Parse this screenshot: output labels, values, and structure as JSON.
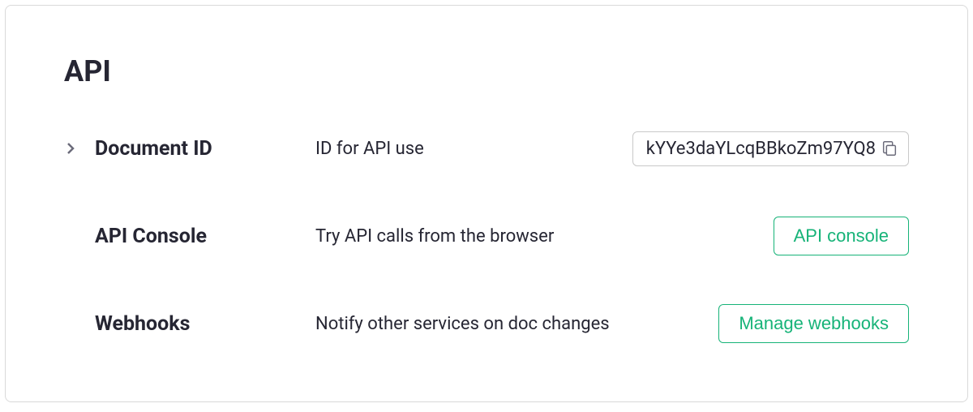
{
  "section": {
    "title": "API"
  },
  "rows": {
    "documentId": {
      "label": "Document ID",
      "description": "ID for API use",
      "value": "kYYe3daYLcqBBkoZm97YQ8"
    },
    "apiConsole": {
      "label": "API Console",
      "description": "Try API calls from the browser",
      "button": "API console"
    },
    "webhooks": {
      "label": "Webhooks",
      "description": "Notify other services on doc changes",
      "button": "Manage webhooks"
    }
  },
  "colors": {
    "accent": "#16b378"
  }
}
